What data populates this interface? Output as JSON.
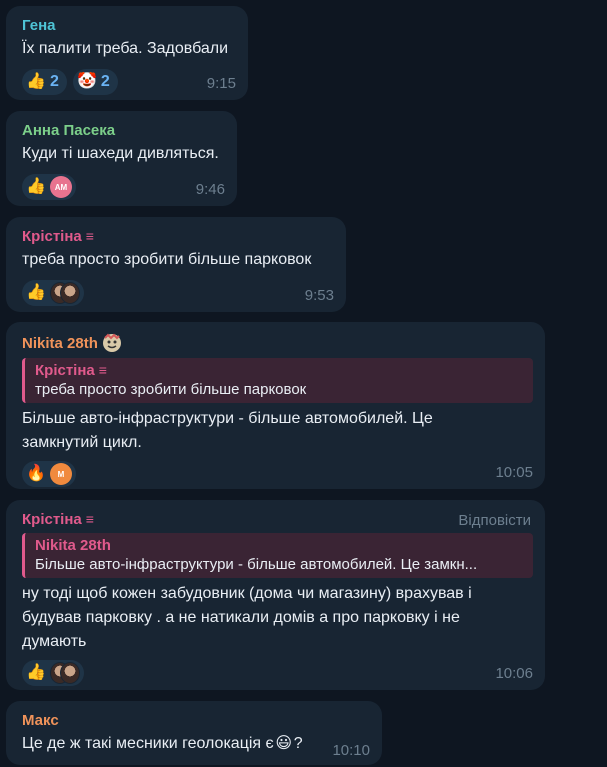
{
  "messages": [
    {
      "sender": "Гена",
      "text": "Їх палити треба. Задовбали",
      "time": "9:15",
      "reactions": [
        {
          "emoji": "👍",
          "count": "2"
        },
        {
          "emoji": "🤡",
          "count": "2"
        }
      ]
    },
    {
      "sender": "Анна Пасека",
      "text": "Куди ті шахеди дивляться.",
      "time": "9:46",
      "reaction_avatar_initials": "АМ"
    },
    {
      "sender": "Крістіна",
      "text": "треба просто зробити більше парковок",
      "time": "9:53"
    },
    {
      "sender": "Nikita 28th",
      "reply_name": "Крістіна",
      "reply_text": "треба просто зробити більше парковок",
      "text_line1": "Більше авто-інфраструктури - більше автомобилей. Це",
      "text_line2": "замкнутий цикл.",
      "time": "10:05",
      "reaction_avatar_initials": "М"
    },
    {
      "sender": "Крістіна",
      "reply_label": "Відповісти",
      "reply_name": "Nikita 28th",
      "reply_text": "Більше авто-інфраструктури - більше автомобилей. Це замкн...",
      "text_line1": "ну тоді щоб кожен забудовник (дома чи магазину) врахував і",
      "text_line2": "будував парковку . а не натикали домів а про парковку і не",
      "text_line3": "думають",
      "time": "10:06"
    },
    {
      "sender": "Макс",
      "text_before": "Це де ж такі месники геолокація є",
      "text_after": "?",
      "time": "10:10"
    }
  ],
  "icons": {
    "thumbs_up": "👍",
    "fire": "🔥",
    "smile": "😃",
    "menu": "≡"
  },
  "colors": {
    "background": "#0e1621",
    "bubble": "#182533",
    "name_pink": "#e05a8c",
    "name_teal": "#4ec4d6",
    "name_green": "#7ccf8a",
    "name_orange": "#f0935a",
    "time_gray": "#6d7f8f",
    "reaction_count": "#6ab3f3"
  }
}
